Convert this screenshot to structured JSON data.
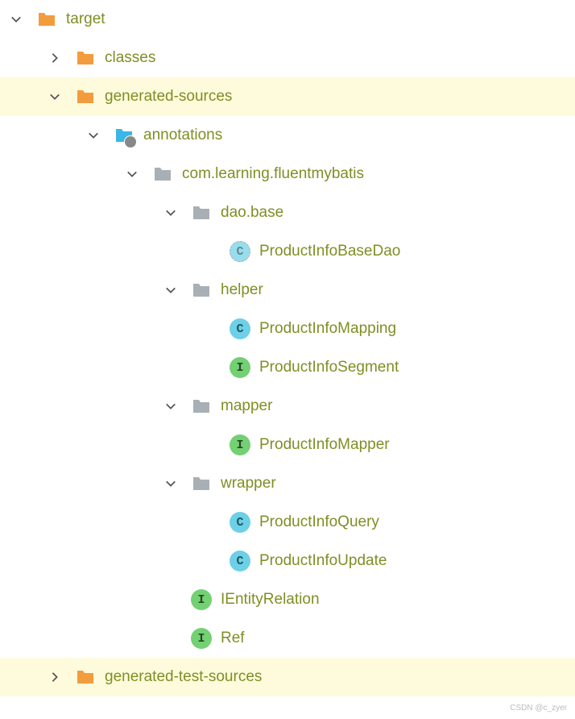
{
  "tree": {
    "target": "target",
    "classes": "classes",
    "generated_sources": "generated-sources",
    "annotations": "annotations",
    "package_root": "com.learning.fluentmybatis",
    "dao_base": "dao.base",
    "product_info_base_dao": "ProductInfoBaseDao",
    "helper": "helper",
    "product_info_mapping": "ProductInfoMapping",
    "product_info_segment": "ProductInfoSegment",
    "mapper": "mapper",
    "product_info_mapper": "ProductInfoMapper",
    "wrapper": "wrapper",
    "product_info_query": "ProductInfoQuery",
    "product_info_update": "ProductInfoUpdate",
    "ientity_relation": "IEntityRelation",
    "ref": "Ref",
    "generated_test_sources": "generated-test-sources"
  },
  "watermark": "CSDN @c_zyer"
}
